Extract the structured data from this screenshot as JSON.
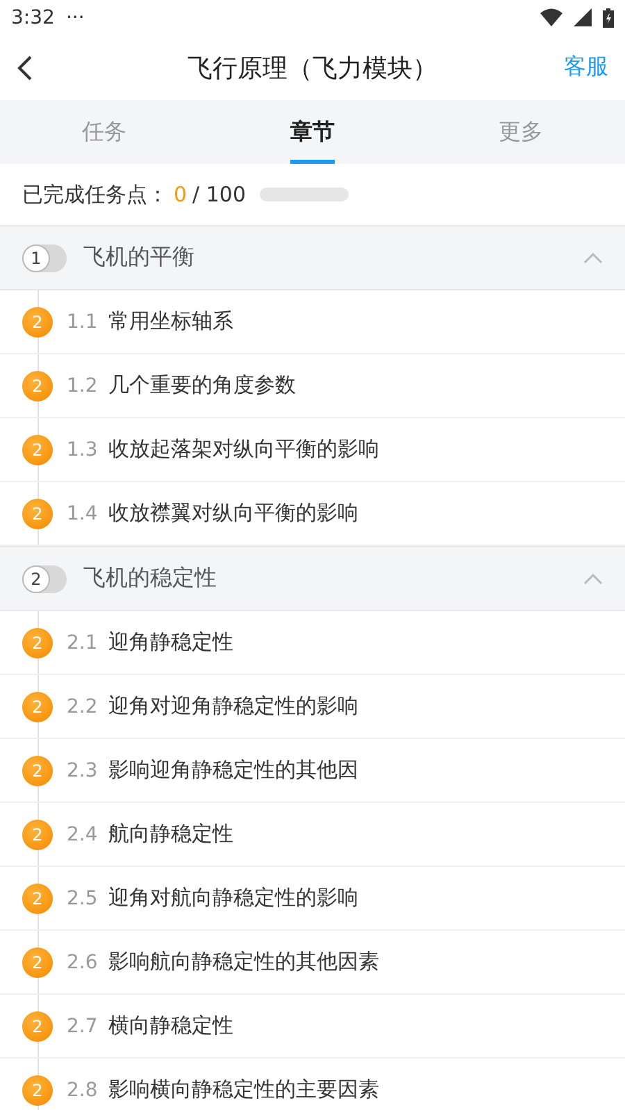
{
  "status_bar": {
    "time": "3:32",
    "dots": "···"
  },
  "header": {
    "title": "飞行原理（飞力模块）",
    "action": "客服"
  },
  "tabs": [
    {
      "label": "任务",
      "selected": false
    },
    {
      "label": "章节",
      "selected": true
    },
    {
      "label": "更多",
      "selected": false
    }
  ],
  "progress": {
    "label": "已完成任务点：",
    "done": "0",
    "total": "/ 100",
    "level": 0
  },
  "chapters": [
    {
      "number": "1",
      "title": "飞机的平衡",
      "expanded": true,
      "items": [
        {
          "badge": "2",
          "number": "1.1",
          "title": "常用坐标轴系"
        },
        {
          "badge": "2",
          "number": "1.2",
          "title": "几个重要的角度参数"
        },
        {
          "badge": "2",
          "number": "1.3",
          "title": "收放起落架对纵向平衡的影响"
        },
        {
          "badge": "2",
          "number": "1.4",
          "title": "收放襟翼对纵向平衡的影响"
        }
      ]
    },
    {
      "number": "2",
      "title": "飞机的稳定性",
      "expanded": true,
      "items": [
        {
          "badge": "2",
          "number": "2.1",
          "title": "迎角静稳定性"
        },
        {
          "badge": "2",
          "number": "2.2",
          "title": "迎角对迎角静稳定性的影响"
        },
        {
          "badge": "2",
          "number": "2.3",
          "title": "影响迎角静稳定性的其他因"
        },
        {
          "badge": "2",
          "number": "2.4",
          "title": "航向静稳定性"
        },
        {
          "badge": "2",
          "number": "2.5",
          "title": "迎角对航向静稳定性的影响"
        },
        {
          "badge": "2",
          "number": "2.6",
          "title": "影响航向静稳定性的其他因素"
        },
        {
          "badge": "2",
          "number": "2.7",
          "title": "横向静稳定性"
        },
        {
          "badge": "2",
          "number": "2.8",
          "title": "影响横向静稳定性的主要因素"
        }
      ]
    }
  ]
}
